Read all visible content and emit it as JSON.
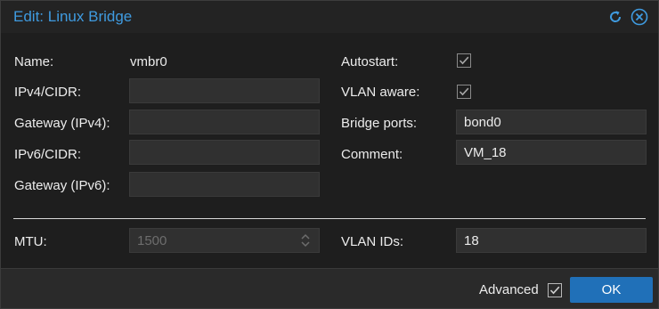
{
  "dialog": {
    "title": "Edit: Linux Bridge",
    "tools": {
      "reset_icon": "refresh-icon",
      "close_icon": "close-icon"
    }
  },
  "left": {
    "name_label": "Name:",
    "name_value": "vmbr0",
    "ipv4_label": "IPv4/CIDR:",
    "ipv4_value": "",
    "gw4_label": "Gateway (IPv4):",
    "gw4_value": "",
    "ipv6_label": "IPv6/CIDR:",
    "ipv6_value": "",
    "gw6_label": "Gateway (IPv6):",
    "gw6_value": ""
  },
  "right": {
    "autostart_label": "Autostart:",
    "autostart_checked": true,
    "vlan_aware_label": "VLAN aware:",
    "vlan_aware_checked": true,
    "bridge_ports_label": "Bridge ports:",
    "bridge_ports_value": "bond0",
    "comment_label": "Comment:",
    "comment_value": "VM_18"
  },
  "advanced": {
    "mtu_label": "MTU:",
    "mtu_value": "1500",
    "vlan_ids_label": "VLAN IDs:",
    "vlan_ids_value": "18"
  },
  "footer": {
    "advanced_label": "Advanced",
    "advanced_checked": true,
    "ok_label": "OK"
  },
  "colors": {
    "accent": "#3f9be0",
    "primary_button": "#2070b8"
  }
}
